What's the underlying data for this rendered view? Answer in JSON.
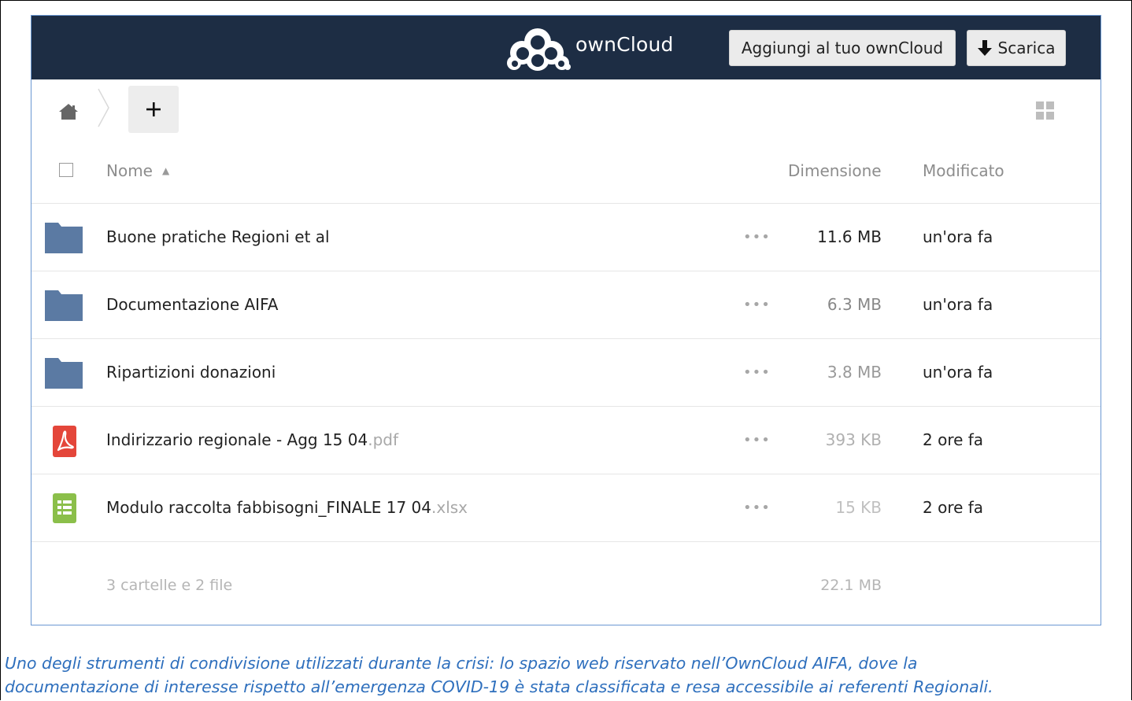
{
  "header": {
    "brand": "ownCloud",
    "add_button_label": "Aggiungi al tuo ownCloud",
    "download_button_label": "Scarica",
    "bg_color": "#1d2d44"
  },
  "table": {
    "col_name": "Nome",
    "col_size": "Dimensione",
    "col_modified": "Modificato",
    "sort_indicator": "▲",
    "actions_label": "•••",
    "rows": [
      {
        "type": "folder-icon",
        "name": "Buone pratiche Regioni et al",
        "ext": "",
        "size": "11.6 MB",
        "size_color": "#222222",
        "modified": "un'ora fa"
      },
      {
        "type": "folder-icon",
        "name": "Documentazione AIFA",
        "ext": "",
        "size": "6.3 MB",
        "size_color": "#888888",
        "modified": "un'ora fa"
      },
      {
        "type": "folder-icon",
        "name": "Ripartizioni donazioni",
        "ext": "",
        "size": "3.8 MB",
        "size_color": "#999999",
        "modified": "un'ora fa"
      },
      {
        "type": "pdf-icon",
        "name": "Indirizzario regionale - Agg 15 04",
        "ext": ".pdf",
        "size": "393 KB",
        "size_color": "#b0b0b0",
        "modified": "2 ore fa"
      },
      {
        "type": "spreadsheet-icon",
        "name": "Modulo raccolta fabbisogni_FINALE 17 04",
        "ext": ".xlsx",
        "size": "15 KB",
        "size_color": "#c0c0c0",
        "modified": "2 ore fa"
      }
    ]
  },
  "summary": {
    "text": "3 cartelle e 2 file",
    "total_size": "22.1 MB"
  },
  "caption": {
    "line1": "Uno degli strumenti di condivisione utilizzati durante la crisi: lo spazio web riservato nell’OwnCloud AIFA, dove la",
    "line2": "documentazione di interesse rispetto all’emergenza COVID-19 è stata classificata e resa accessibile ai referenti Regionali."
  },
  "colors": {
    "folder": "#5b7aa3",
    "pdf": "#e4463a",
    "spreadsheet": "#8bbf4a",
    "caption": "#2e6fbd"
  }
}
